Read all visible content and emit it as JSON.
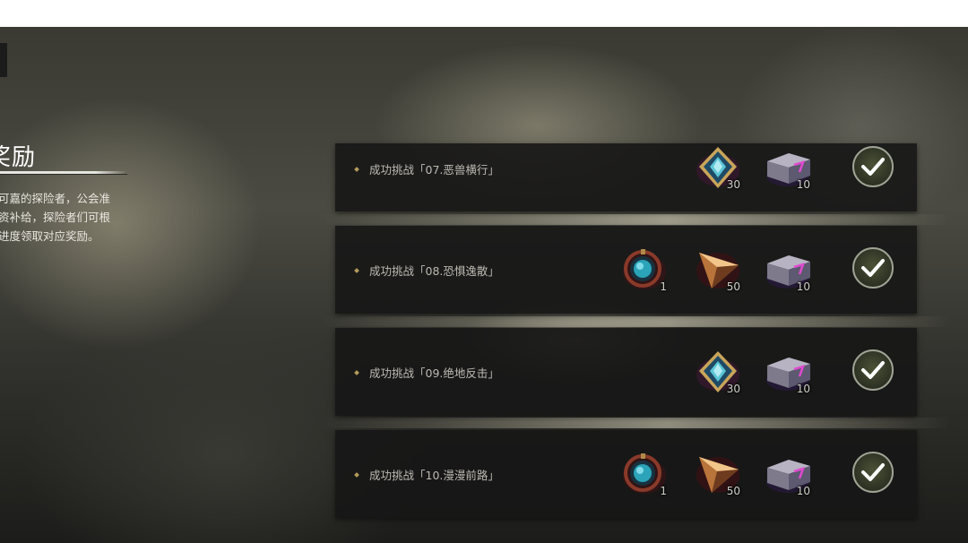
{
  "panel": {
    "title": "奖励",
    "description_lines": [
      "可嘉的探险者，公会准",
      "资补给，探险者们可根",
      "进度领取对应奖励。"
    ]
  },
  "tasks": [
    {
      "label": "成功挑战「07.恶兽横行」",
      "rewards": [
        {
          "icon": "blue-crystal-card-icon",
          "qty": "30"
        },
        {
          "icon": "purple-box-icon",
          "qty": "10"
        }
      ],
      "claimed": true
    },
    {
      "label": "成功挑战「08.恐惧逸散」",
      "rewards": [
        {
          "icon": "teal-gem-medallion-icon",
          "qty": "1"
        },
        {
          "icon": "orange-shard-icon",
          "qty": "50"
        },
        {
          "icon": "purple-box-icon",
          "qty": "10"
        }
      ],
      "claimed": true
    },
    {
      "label": "成功挑战「09.绝地反击」",
      "rewards": [
        {
          "icon": "blue-crystal-card-icon",
          "qty": "30"
        },
        {
          "icon": "purple-box-icon",
          "qty": "10"
        }
      ],
      "claimed": true
    },
    {
      "label": "成功挑战「10.漫漫前路」",
      "rewards": [
        {
          "icon": "teal-gem-medallion-icon",
          "qty": "1"
        },
        {
          "icon": "orange-shard-icon",
          "qty": "50"
        },
        {
          "icon": "purple-box-icon",
          "qty": "10"
        }
      ],
      "claimed": true
    }
  ]
}
